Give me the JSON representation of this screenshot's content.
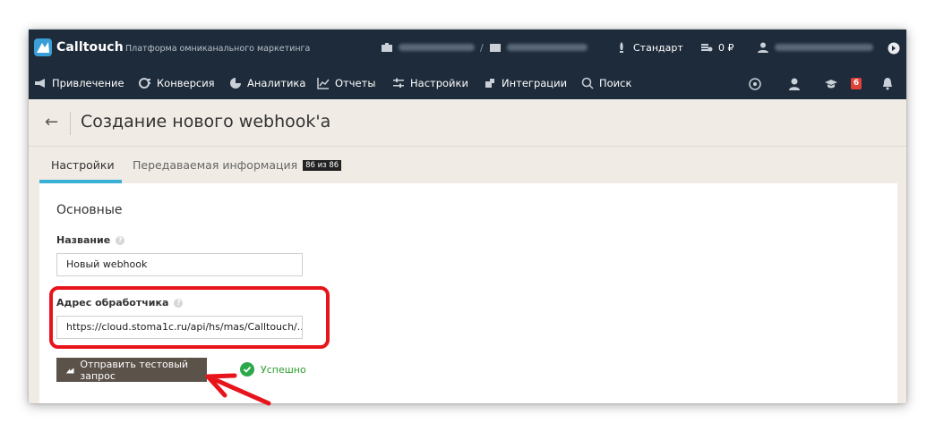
{
  "topbar": {
    "brand": "Calltouch",
    "tagline": "Платформа омниканального маркетинга",
    "separator": "/",
    "plan": "Стандарт",
    "balance": "0 ₽",
    "notification_count": "6"
  },
  "nav": {
    "items": [
      {
        "label": "Привлечение",
        "icon": "megaphone-icon"
      },
      {
        "label": "Конверсия",
        "icon": "conversion-icon"
      },
      {
        "label": "Аналитика",
        "icon": "pie-chart-icon"
      },
      {
        "label": "Отчеты",
        "icon": "line-chart-icon"
      },
      {
        "label": "Настройки",
        "icon": "sliders-icon"
      },
      {
        "label": "Интеграции",
        "icon": "puzzle-icon"
      },
      {
        "label": "Поиск",
        "icon": "search-icon"
      }
    ]
  },
  "header": {
    "back_symbol": "←",
    "title": "Создание нового webhook'а"
  },
  "tabs": [
    {
      "label": "Настройки"
    },
    {
      "label": "Передаваемая информация",
      "badge": "86 из 86"
    }
  ],
  "form": {
    "section_title": "Основные",
    "name_label": "Название",
    "name_value": "Новый webhook",
    "address_label": "Адрес обработчика",
    "address_value": "https://cloud.stoma1c.ru/api/hs/mas/Calltouch/...",
    "send_button": "Отправить тестовый запрос",
    "success_text": "Успешно"
  },
  "colors": {
    "topbar_bg": "#1e2b3a",
    "highlight": "#e8141c",
    "tab_accent": "#3ab0d6",
    "success": "#2ba84a",
    "button_bg": "#5b524a"
  }
}
